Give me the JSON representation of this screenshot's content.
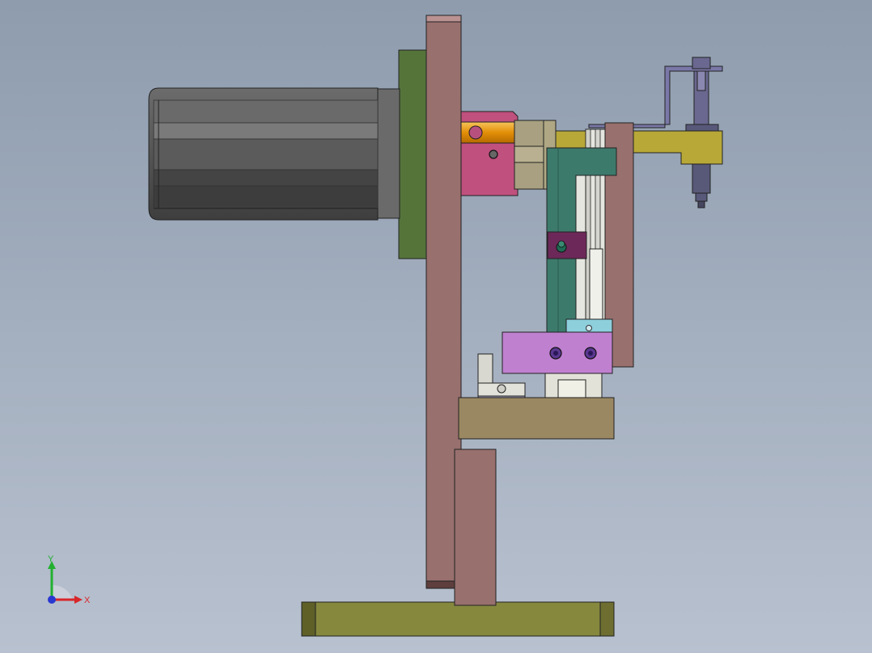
{
  "view": {
    "background_top": "#8e9cae",
    "background_bottom": "#b8c1cf"
  },
  "triad": {
    "x_label": "X",
    "y_label": "Y",
    "x_color": "#d8262a",
    "y_color": "#22b030",
    "z_color": "#2838d0"
  },
  "colors": {
    "motor_body": "#5e5e5e",
    "motor_flange": "#55743a",
    "upright_plate": "#98706e",
    "cylinder_block": "#c0507e",
    "piston_rod": "#e59a10",
    "slide_guide": "#3c7a6c",
    "holder_block": "#c080d0",
    "top_bracket": "#b8a838",
    "base_block": "#9a8862",
    "base_plate": "#86883e",
    "probe_pin": "#585878"
  }
}
